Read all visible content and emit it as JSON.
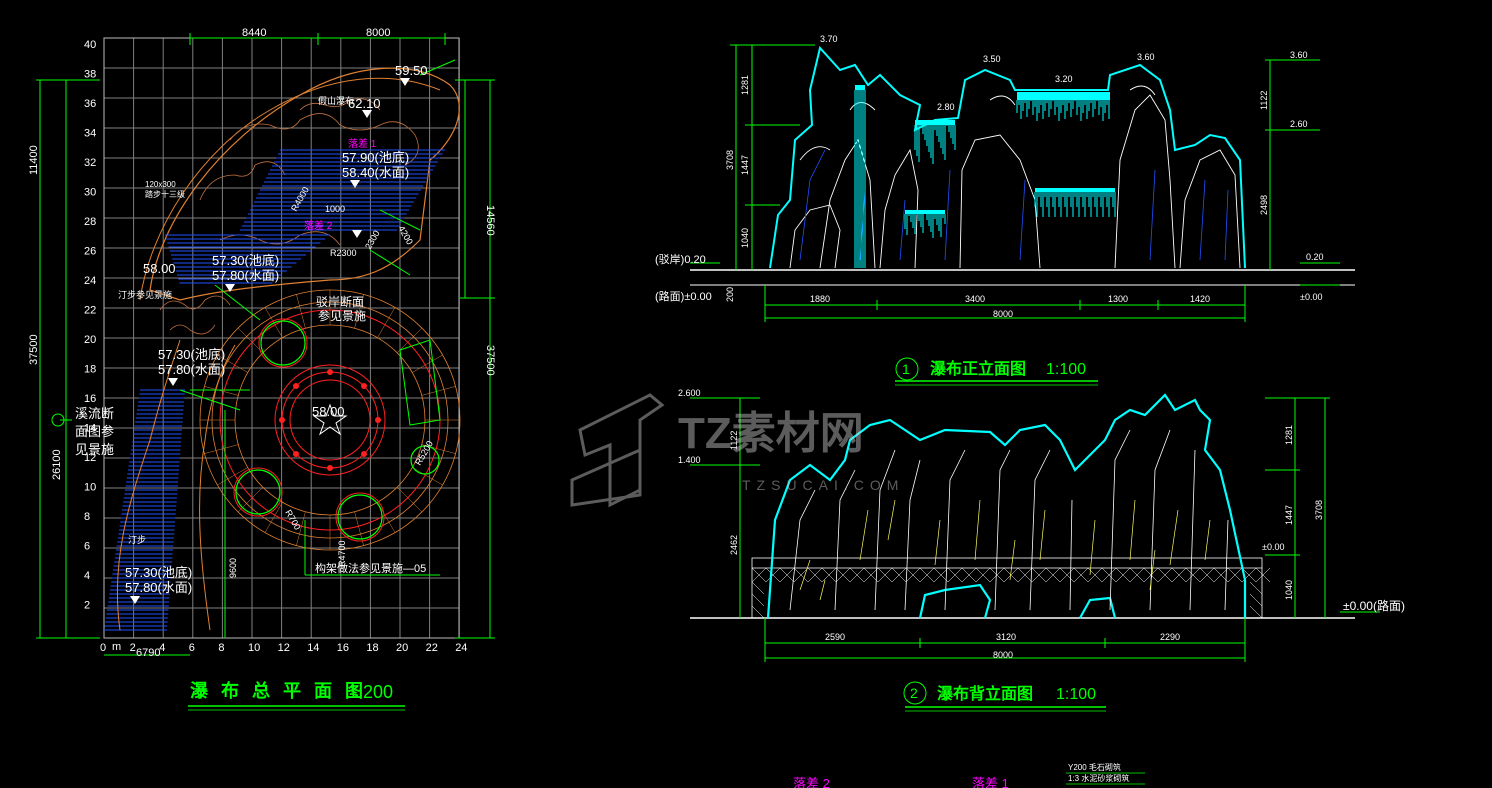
{
  "plan": {
    "title": "瀑 布 总 平 面 图",
    "scale": "1:200",
    "grid_y_labels": [
      "40",
      "38",
      "36",
      "34",
      "32",
      "30",
      "28",
      "26",
      "24",
      "22",
      "20",
      "18",
      "16",
      "14",
      "12",
      "10",
      "8",
      "6",
      "4",
      "2"
    ],
    "grid_x_labels": [
      "0",
      "2",
      "4",
      "6",
      "8",
      "10",
      "12",
      "14",
      "16",
      "18",
      "20",
      "22",
      "24"
    ],
    "origin_unit": "m",
    "dim_top": [
      "8440",
      "8000"
    ],
    "dim_left": [
      "11400",
      "37500",
      "26100"
    ],
    "dim_right": [
      "14560",
      "37500"
    ],
    "dim_bottom": "6790",
    "elev_labels": [
      "59.50",
      "62.10",
      "57.90(池底)",
      "58.40(水面)",
      "58.00",
      "57.30(池底)",
      "57.80(水面)",
      "57.30(池底)",
      "57.80(水面)",
      "58.00",
      "57.30(池底)",
      "57.80(水面)"
    ],
    "note_fall1": "落差 1",
    "note_fall2": "落差 2",
    "note_fake_hill": "假山瀑布",
    "note_step": "120x300",
    "note_step2": "踏步十三级",
    "note_shore": "汀步参见景施",
    "note_stream1": "溪流断",
    "note_stream2": "面图参",
    "note_stream3": "见景施",
    "note_bank1": "驳岸断面",
    "note_bank2": "参见景施",
    "note_struct": "构架做法参见景施—05",
    "note_ting": "汀步",
    "dim_misc": [
      "R4000",
      "1000",
      "4200",
      "2300",
      "R2300",
      "R700",
      "R4700",
      "9600",
      "R5200"
    ]
  },
  "front": {
    "title": "瀑布正立面图",
    "num": "1",
    "scale": "1:100",
    "top_elev": [
      "3.70",
      "3.50",
      "3.20",
      "3.60",
      "2.80",
      "3.60",
      "2.60"
    ],
    "left_dims": [
      "1281",
      "3708",
      "1447",
      "1040"
    ],
    "right_dims": [
      "1122",
      "2498"
    ],
    "bank": "(驳岸)0.20",
    "road": "(路面)±0.00",
    "road_right": "±0.00",
    "bank_right": "0.20",
    "base_dim": "200",
    "bottom_dims": [
      "1880",
      "3400",
      "1300",
      "1420"
    ],
    "total": "8000"
  },
  "back": {
    "title": "瀑布背立面图",
    "num": "2",
    "scale": "1:100",
    "left_elev": [
      "2.600",
      "1.400"
    ],
    "left_dims": [
      "1122",
      "2462"
    ],
    "right_dims": [
      "1281",
      "3708",
      "1447",
      "1040"
    ],
    "zero": "±0.00",
    "road": "±0.00(路面)",
    "bottom_dims": [
      "2590",
      "3120",
      "2290"
    ],
    "total": "8000"
  },
  "bottom_notes": {
    "fall2": "落差 2",
    "fall1": "落差 1",
    "spec1": "Y200 毛石砌筑",
    "spec2": "1:3 水泥砂浆砌筑"
  },
  "watermark": {
    "brand": "TZ素材网",
    "url": "TZSUCAI.COM"
  },
  "colors": {
    "bg": "#000000",
    "green": "#00ff00",
    "cyan": "#00ffff",
    "white": "#ffffff",
    "magenta": "#ff00ff",
    "red": "#ff2020",
    "orange": "#e08030",
    "blue": "#2050ff",
    "yellow": "#ffff60"
  }
}
